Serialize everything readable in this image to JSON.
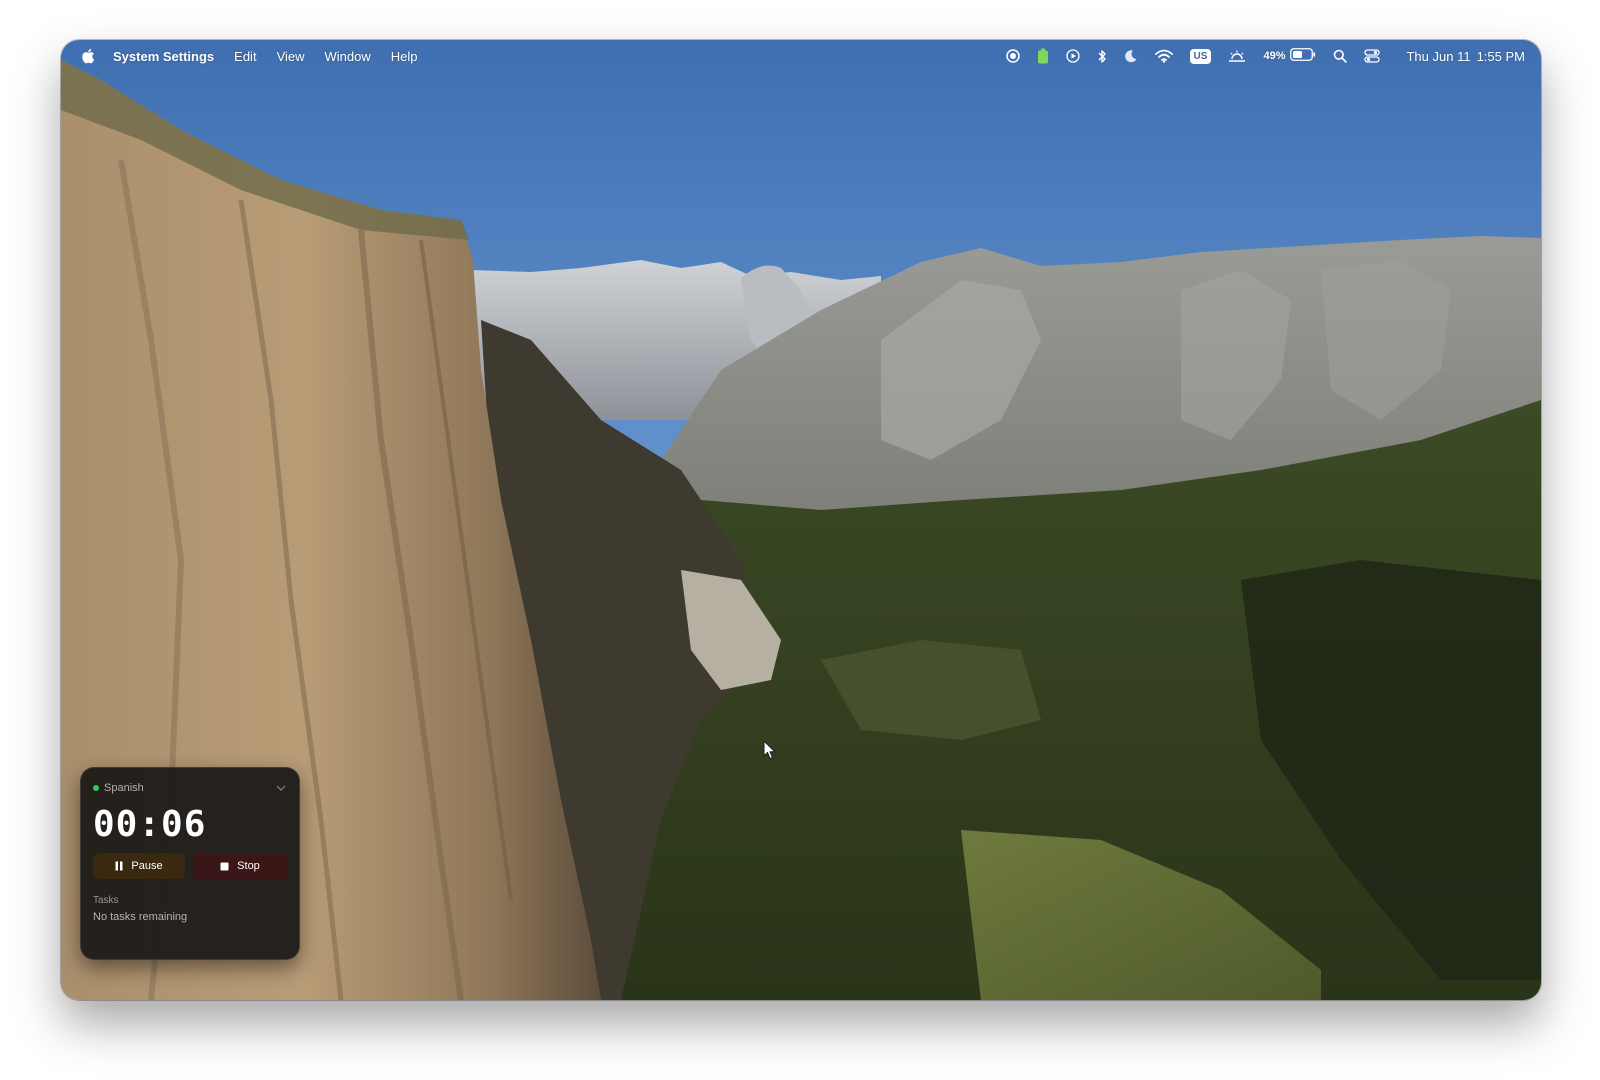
{
  "menubar": {
    "apple_icon": "apple-logo-icon",
    "app_name": "System Settings",
    "menus": [
      "Edit",
      "View",
      "Window",
      "Help"
    ],
    "status_icons": [
      "screen-record-icon",
      "battery-app-icon",
      "play-icon",
      "bluetooth-icon",
      "moon-icon",
      "wifi-icon"
    ],
    "keyboard_layout": "US",
    "battery_percent": "49%",
    "date": "Thu Jun 11",
    "time": "1:55 PM"
  },
  "timer_widget": {
    "project": "Spanish",
    "elapsed": "00:06",
    "pause_label": "Pause",
    "stop_label": "Stop",
    "tasks_label": "Tasks",
    "tasks_empty": "No tasks remaining",
    "status_color": "#34c759"
  }
}
